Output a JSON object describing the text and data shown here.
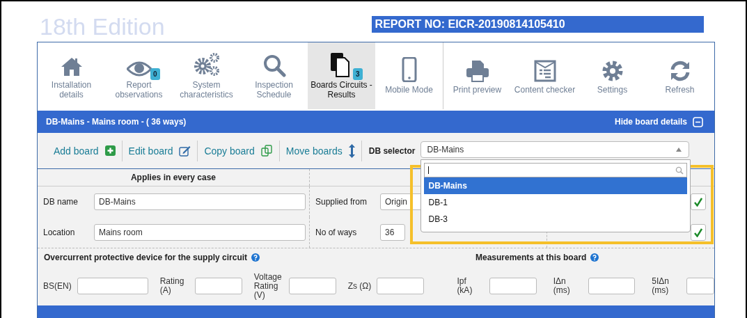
{
  "header": {
    "title": "18th Edition",
    "report_no": "REPORT NO: EICR-20190814105410"
  },
  "nav_tabs": [
    {
      "label": "Installation details",
      "selected": false
    },
    {
      "label": "Report observations",
      "badge": "0",
      "selected": false
    },
    {
      "label": "System characteristics",
      "selected": false
    },
    {
      "label": "Inspection Schedule",
      "selected": false
    },
    {
      "label": "Boards Circuits - Results",
      "badge": "3",
      "selected": true
    },
    {
      "label": "Mobile Mode",
      "selected": false
    }
  ],
  "tools": [
    {
      "label": "Print preview"
    },
    {
      "label": "Content checker"
    },
    {
      "label": "Settings"
    },
    {
      "label": "Refresh"
    }
  ],
  "board_bar": {
    "title": "DB-Mains - Mains room - ( 36 ways)",
    "toggle": "Hide board details"
  },
  "actions": [
    {
      "label": "Add board"
    },
    {
      "label": "Edit board"
    },
    {
      "label": "Copy board"
    },
    {
      "label": "Move boards"
    }
  ],
  "db_selector": {
    "label": "DB selector",
    "value": "DB-Mains",
    "expanded": true,
    "options": [
      {
        "label": "DB-Mains",
        "selected": true
      },
      {
        "label": "DB-1",
        "selected": false
      },
      {
        "label": "DB-3",
        "selected": false
      }
    ]
  },
  "board_form": {
    "heading": "Applies in every case",
    "left_fields": [
      {
        "label": "DB name",
        "value": "DB-Mains"
      },
      {
        "label": "Location",
        "value": "Mains room"
      }
    ],
    "middle_fields": [
      {
        "label": "Supplied from",
        "value": "Origin"
      },
      {
        "label": "No of ways",
        "value": "36"
      }
    ]
  },
  "overcurrent": {
    "title": "Overcurrent protective device for the supply circuit",
    "fields": [
      {
        "label": "BS(EN)"
      },
      {
        "label": "Rating (A)"
      },
      {
        "label": "Voltage Rating (V)"
      },
      {
        "label": "Zs (Ω)"
      }
    ]
  },
  "measurements": {
    "title": "Measurements at this board",
    "fields": [
      {
        "label": "Ipf (kA)"
      },
      {
        "label": "IΔn (ms)"
      },
      {
        "label": "5IΔn (ms)"
      }
    ]
  }
}
